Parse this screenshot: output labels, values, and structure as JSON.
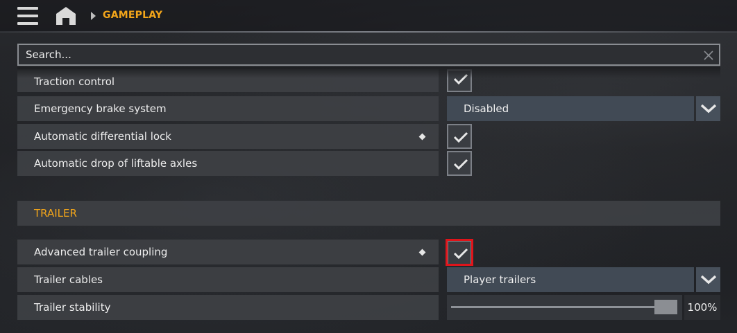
{
  "header": {
    "breadcrumb": "GAMEPLAY",
    "menu_icon": "hamburger-menu-icon",
    "home_icon": "home-icon",
    "breadcrumb_separator_icon": "chevron-right-icon"
  },
  "search": {
    "placeholder": "Search...",
    "clear_icon": "close-icon"
  },
  "settings": {
    "traction_control": {
      "label": "Traction control",
      "checked": true
    },
    "emergency_brake": {
      "label": "Emergency brake system",
      "value": "Disabled"
    },
    "auto_diff_lock": {
      "label": "Automatic differential lock",
      "checked": true,
      "has_diamond": true
    },
    "auto_drop_axles": {
      "label": "Automatic drop of liftable axles",
      "checked": true
    }
  },
  "trailer_section": {
    "title": "TRAILER",
    "advanced_coupling": {
      "label": "Advanced trailer coupling",
      "checked": true,
      "has_diamond": true,
      "highlighted": true
    },
    "trailer_cables": {
      "label": "Trailer cables",
      "value": "Player trailers"
    },
    "trailer_stability": {
      "label": "Trailer stability",
      "value": "100%",
      "level": 1.0
    }
  },
  "colors": {
    "accent": "#f2a51a",
    "highlight": "#e0141a",
    "dropdown": "#414a55"
  }
}
